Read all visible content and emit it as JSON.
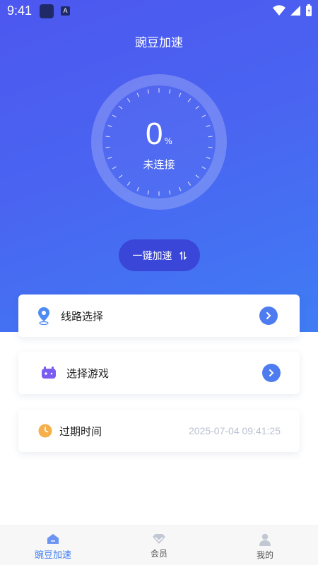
{
  "status_bar": {
    "time": "9:41",
    "notif_letter": "A"
  },
  "header": {
    "title": "豌豆加速"
  },
  "dial": {
    "percent": "0",
    "percent_sign": "%",
    "status": "未连接"
  },
  "boost_button": {
    "label": "一键加速",
    "icon": "swap-arrows-icon"
  },
  "cards": {
    "route": {
      "label": "线路选择",
      "icon": "location-pin-icon"
    },
    "game": {
      "label": "选择游戏",
      "icon": "gamepad-icon"
    },
    "expire": {
      "label": "过期时间",
      "value": "2025-07-04 09:41:25",
      "icon": "clock-icon"
    }
  },
  "tabs": [
    {
      "label": "豌豆加速",
      "icon": "home-icon",
      "active": true
    },
    {
      "label": "会员",
      "icon": "diamond-icon",
      "active": false
    },
    {
      "label": "我的",
      "icon": "user-icon",
      "active": false
    }
  ],
  "colors": {
    "gradient_start": "#4c57ef",
    "gradient_end": "#3f7cf4",
    "accent": "#3f7cf4",
    "arrow": "#4e7cf0",
    "clock": "#f5b04c"
  }
}
